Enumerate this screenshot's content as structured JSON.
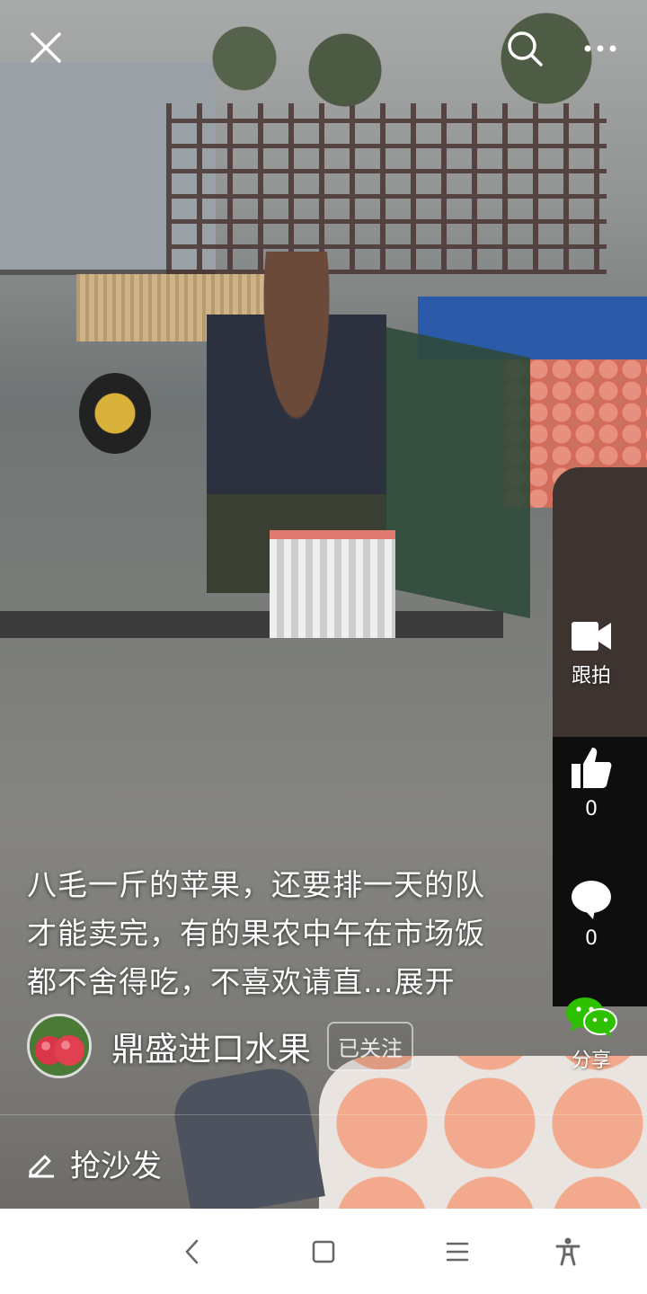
{
  "top_bar": {
    "close_icon": "close-icon",
    "search_icon": "search-icon",
    "more_icon": "more-icon"
  },
  "actions": {
    "follow_shoot": {
      "icon": "video-camera-icon",
      "label": "跟拍"
    },
    "like": {
      "icon": "thumbs-up-icon",
      "count": "0"
    },
    "comment": {
      "icon": "comment-bubble-icon",
      "count": "0"
    },
    "share": {
      "icon": "wechat-icon",
      "label": "分享"
    }
  },
  "caption": {
    "line1": "八毛一斤的苹果，还要排一天的队",
    "line2": "才能卖完，有的果农中午在市场饭",
    "line3": "都不舍得吃，不喜欢请直...展开"
  },
  "author": {
    "name": "鼎盛进口水果",
    "follow_status": "已关注"
  },
  "comment_box": {
    "icon": "pencil-icon",
    "label": "抢沙发"
  },
  "navbar": {
    "back_icon": "back-icon",
    "home_icon": "home-icon",
    "menu_icon": "menu-icon",
    "accessibility_icon": "accessibility-icon"
  },
  "colors": {
    "wechat_green": "#2dc100",
    "overlay_text": "#ffffff",
    "navbar_bg": "#ffffff"
  }
}
